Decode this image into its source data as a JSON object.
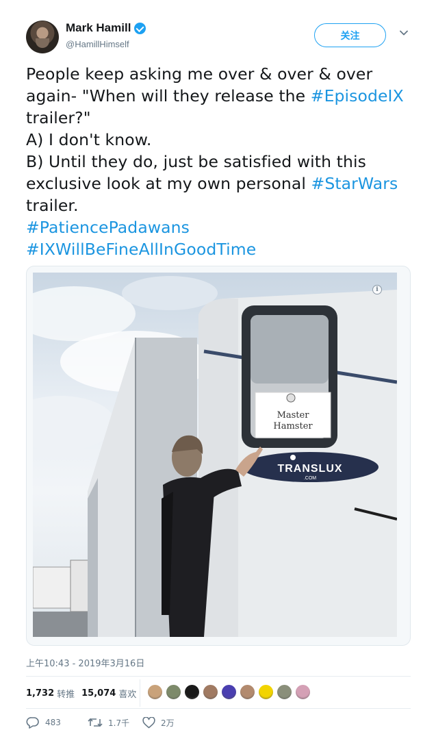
{
  "user": {
    "display_name": "Mark Hamill",
    "handle": "@HamillHimself",
    "verified": true,
    "avatar": "avatar-photo"
  },
  "follow_button": {
    "label": "关注"
  },
  "more_menu": {
    "icon": "chevron-down-icon"
  },
  "tweet": {
    "lines": [
      [
        {
          "t": "People keep asking me over & over & over"
        }
      ],
      [
        {
          "t": "again- \"When will they release the "
        },
        {
          "t": "#EpisodeIX",
          "tag": true
        }
      ],
      [
        {
          "t": "trailer?\""
        }
      ],
      [
        {
          "t": "A) I don't know."
        }
      ],
      [
        {
          "t": "B) Until they do, just be satisfied with this"
        }
      ],
      [
        {
          "t": "exclusive look at my own personal "
        },
        {
          "t": "#StarWars",
          "tag": true
        }
      ],
      [
        {
          "t": "trailer."
        }
      ],
      [
        {
          "t": "#PatiencePadawans",
          "tag": true
        }
      ],
      [
        {
          "t": "#IXWillBeFineAllInGoodTime",
          "tag": true
        }
      ]
    ]
  },
  "media": {
    "photo_sign_line1": "Master",
    "photo_sign_line2": "Hamster",
    "photo_logo_text": "TRANSLUX",
    "photo_logo_sub": ".COM",
    "info_icon": "i"
  },
  "timestamp": "上午10:43 - 2019年3月16日",
  "stats": {
    "retweets": "1,732",
    "retweets_label": "转推",
    "likes": "15,074",
    "likes_label": "喜欢"
  },
  "likers": [
    "#c9a27a",
    "#7d8a6a",
    "#1a1a1a",
    "#a07a62",
    "#4a3fb0",
    "#b28a6e",
    "#f2d400",
    "#8a8f7a",
    "#d4a0b5"
  ],
  "actions": {
    "replies": "483",
    "retweets": "1.7千",
    "likes": "2万"
  },
  "colors": {
    "accent": "#1da1f2",
    "link": "#1b95e0",
    "muted": "#657786"
  }
}
